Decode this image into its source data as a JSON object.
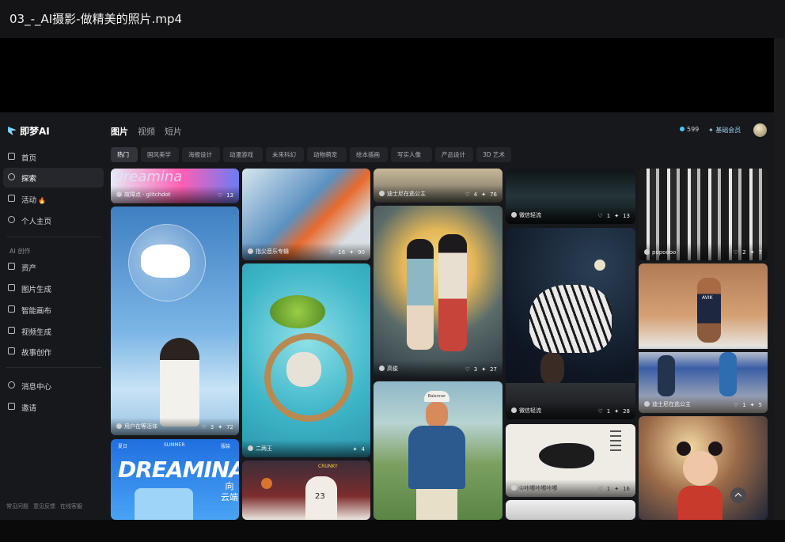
{
  "window": {
    "title": "03_-_AI摄影-做精美的照片.mp4"
  },
  "app": {
    "logo_text": "即梦AI",
    "nav": [
      {
        "label": "首页",
        "icon": "home-icon"
      },
      {
        "label": "探索",
        "icon": "compass-icon"
      },
      {
        "label": "活动",
        "icon": "gift-icon",
        "fire": "🔥"
      },
      {
        "label": "个人主页",
        "icon": "user-icon"
      }
    ],
    "section_label": "AI 创作",
    "create_nav": [
      {
        "label": "资产",
        "icon": "folder-icon"
      },
      {
        "label": "图片生成",
        "icon": "image-icon"
      },
      {
        "label": "智能画布",
        "icon": "canvas-icon"
      },
      {
        "label": "视频生成",
        "icon": "video-icon"
      },
      {
        "label": "故事创作",
        "icon": "story-icon"
      }
    ],
    "bottom_nav": [
      {
        "label": "消息中心",
        "icon": "bell-icon"
      },
      {
        "label": "邀请",
        "icon": "invite-icon"
      }
    ],
    "footer_links": [
      "常见问题",
      "意见反馈",
      "在线客服"
    ]
  },
  "header": {
    "tabs": [
      "图片",
      "视频",
      "短片"
    ],
    "credits": "599",
    "member_label": "基础会员"
  },
  "filters": [
    "热门",
    "国风美学",
    "海报设计",
    "动漫游戏",
    "未来科幻",
    "动物萌宠",
    "绘本插画",
    "写实人像",
    "产品设计",
    "3D 艺术"
  ],
  "cards": {
    "c1a": {
      "author": "故障点 · glitchdot",
      "likes": "13",
      "brand": "Dreamina"
    },
    "c1b": {
      "author": "用户在等活体",
      "likes": "3",
      "uses": "72"
    },
    "c1c": {
      "top_left": "夏日",
      "top_mid": "SUMMER",
      "top_right": "服装",
      "title": "DREAMINA",
      "side1": "向",
      "side2": "云端"
    },
    "c2a": {
      "author": "指尖音乐专辑",
      "likes": "16",
      "uses": "90"
    },
    "c2b": {
      "author": "二两王",
      "likes": "",
      "uses": "4"
    },
    "c2c": {
      "jersey": "23",
      "brand": "CRUNKY"
    },
    "c3a": {
      "author": "迪士尼在逃公主",
      "likes": "4",
      "uses": "76"
    },
    "c3b": {
      "author": "高俊",
      "likes": "3",
      "uses": "27"
    },
    "c3c": {
      "cap": "Balenner"
    },
    "c4a": {
      "author": "微信轻流",
      "likes": "1",
      "uses": "13"
    },
    "c4b": {
      "author": "微信轻流",
      "likes": "1",
      "uses": "28"
    },
    "c4c": {
      "author": "①咔嘟咔嘟咔嘟",
      "likes": "1",
      "uses": "16"
    },
    "c5a": {
      "author": "popoooo",
      "likes": "2",
      "uses": "7"
    },
    "c5b": {
      "author": "迪士尼在逃公主",
      "likes": "1",
      "uses": "5",
      "bib": "AVIK"
    }
  }
}
